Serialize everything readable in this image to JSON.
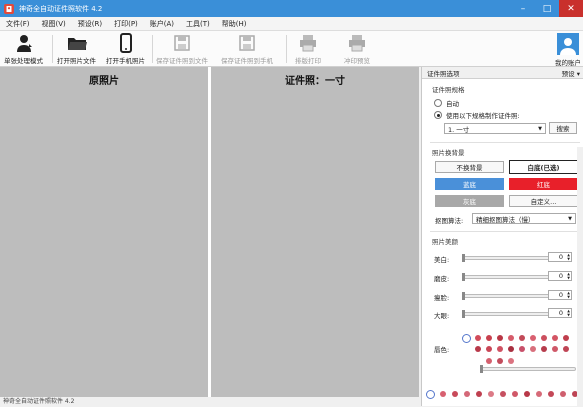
{
  "window": {
    "title": "神奇全自动证件照软件 4.2"
  },
  "menu": [
    "文件(F)",
    "视图(V)",
    "预设(R)",
    "打印(P)",
    "账户(A)",
    "工具(T)",
    "帮助(H)"
  ],
  "toolbar": {
    "single_mode": "单张处理模式",
    "open_file": "打开照片文件",
    "open_phone": "打开手机照片",
    "save_file": "保存证件照到文件",
    "save_phone": "保存证件照到手机",
    "print_layout": "排版打印",
    "print_preview": "冲印预览",
    "account": "我的账户"
  },
  "panels": {
    "original": "原照片",
    "id_photo": "证件照：一寸"
  },
  "side": {
    "header": "证件照选项",
    "preset": "预设 ▾",
    "spec_title": "证件照规格",
    "radio_auto": "自动",
    "radio_spec": "使用以下规格制作证件照:",
    "spec_value": "1. 一寸",
    "search": "搜索",
    "bg_title": "照片换背景",
    "no_change": "不换背景",
    "white": "白底(已选)",
    "blue": "蓝底",
    "red": "红底",
    "gray": "灰底",
    "custom": "自定义...",
    "algo_label": "抠图算法:",
    "algo_value": "精细抠图算法（慢）",
    "beauty_title": "照片美颜",
    "whiten": "美白:",
    "smooth": "磨皮:",
    "thin": "瘦脸:",
    "eyes": "大眼:",
    "lip": "唇色:",
    "whiten_val": "0",
    "smooth_val": "0",
    "thin_val": "0",
    "eyes_val": "0"
  },
  "colors": {
    "blue_bg": "#4a90d9",
    "red_bg": "#e8202a",
    "gray_bg": "#a8a8a8",
    "titlebar": "#3a8fd8"
  },
  "status": "神奇全自动证件照软件 4.2"
}
